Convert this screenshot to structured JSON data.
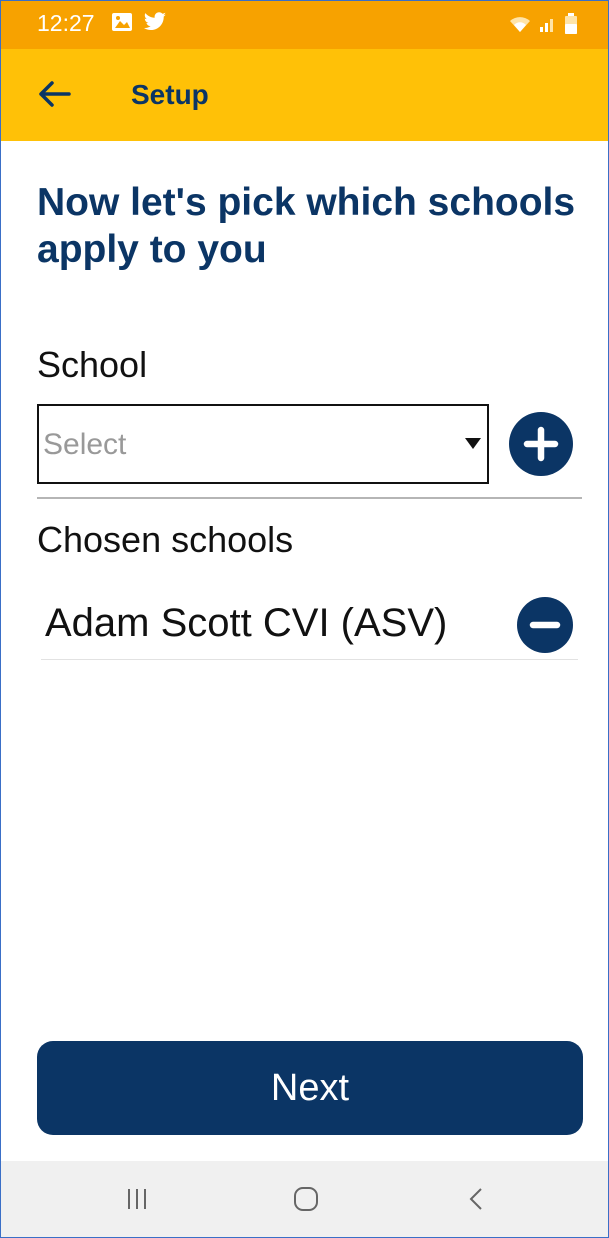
{
  "status_bar": {
    "time": "12:27",
    "icons": [
      "image-icon",
      "twitter-icon",
      "wifi-icon",
      "signal-icon",
      "battery-icon"
    ]
  },
  "app_bar": {
    "title": "Setup",
    "back_icon": "back-arrow-icon"
  },
  "main": {
    "heading": "Now let's pick which schools apply to you",
    "school_label": "School",
    "school_select": {
      "placeholder": "Select",
      "value": ""
    },
    "add_icon": "plus-circle-icon",
    "chosen_label": "Chosen schools",
    "chosen_schools": [
      {
        "name": "Adam Scott CVI (ASV)",
        "remove_icon": "minus-circle-icon"
      }
    ]
  },
  "footer": {
    "next_label": "Next"
  },
  "nav_bar": {
    "icons": [
      "recents-icon",
      "home-icon",
      "back-icon"
    ]
  },
  "colors": {
    "status_bar": "#f7a200",
    "app_bar": "#ffc107",
    "primary": "#0b3565"
  }
}
